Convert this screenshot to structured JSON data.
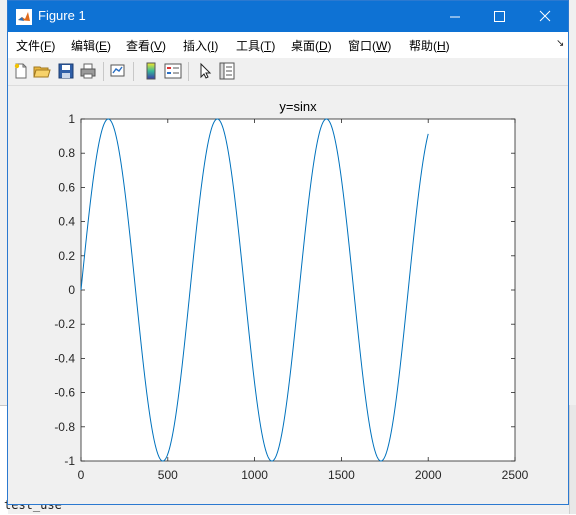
{
  "window": {
    "title": "Figure 1"
  },
  "titlebar_buttons": {
    "minimize": "—",
    "maximize": "☐",
    "close": "✕"
  },
  "menu": [
    {
      "label": "文件(",
      "key": "F",
      "tail": ")"
    },
    {
      "label": "编辑(",
      "key": "E",
      "tail": ")"
    },
    {
      "label": "查看(",
      "key": "V",
      "tail": ")"
    },
    {
      "label": "插入(",
      "key": "I",
      "tail": ")"
    },
    {
      "label": "工具(",
      "key": "T",
      "tail": ")"
    },
    {
      "label": "桌面(",
      "key": "D",
      "tail": ")"
    },
    {
      "label": "窗口(",
      "key": "W",
      "tail": ")"
    },
    {
      "label": "帮助(",
      "key": "H",
      "tail": ")"
    }
  ],
  "toolbar": [
    "new-file-icon",
    "open-folder-icon",
    "save-icon",
    "print-icon",
    "link-plot-icon",
    "insert-colorbar-icon",
    "insert-legend-icon",
    "select-arrow-icon",
    "property-inspector-icon"
  ],
  "background_text": "test_use",
  "colors": {
    "line": "#0072bd",
    "titlebar": "#0e72d4"
  },
  "chart_data": {
    "type": "line",
    "title": "y=sinx",
    "xlabel": "",
    "ylabel": "",
    "xlim": [
      0,
      2500
    ],
    "ylim": [
      -1,
      1
    ],
    "xticks": [
      0,
      500,
      1000,
      1500,
      2000,
      2500
    ],
    "yticks": [
      -1,
      -0.8,
      -0.6,
      -0.4,
      -0.2,
      0,
      0.2,
      0.4,
      0.6,
      0.8,
      1
    ],
    "ytick_labels": [
      "-1",
      "-0.8",
      "-0.6",
      "-0.4",
      "-0.2",
      "0",
      "0.2",
      "0.4",
      "0.6",
      "0.8",
      "1"
    ],
    "series": [
      {
        "function": "sin",
        "x_start": 0,
        "x_end": 2000,
        "x_per_radian": 100,
        "description_values": {
          "y_at_0": 0,
          "first_peak_x": 157,
          "first_trough_x": 471,
          "y_at_2000": 0.91
        }
      }
    ],
    "grid": false,
    "legend": "none"
  }
}
